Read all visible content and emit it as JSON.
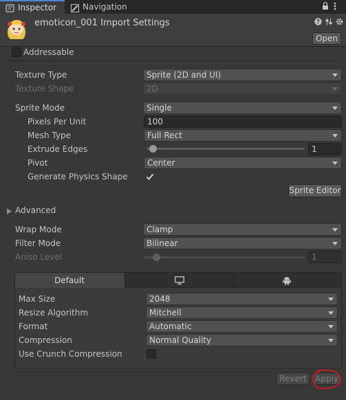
{
  "tabs": {
    "inspector": "Inspector",
    "navigation": "Navigation"
  },
  "header": {
    "title": "emoticon_001 Import Settings",
    "open_label": "Open"
  },
  "addressable": {
    "label": "Addressable",
    "checked": false
  },
  "texture_type": {
    "label": "Texture Type",
    "value": "Sprite (2D and UI)"
  },
  "texture_shape": {
    "label": "Texture Shape",
    "value": "2D"
  },
  "sprite_mode": {
    "label": "Sprite Mode",
    "value": "Single"
  },
  "pixels_per_unit": {
    "label": "Pixels Per Unit",
    "value": "100"
  },
  "mesh_type": {
    "label": "Mesh Type",
    "value": "Full Rect"
  },
  "extrude_edges": {
    "label": "Extrude Edges",
    "value": "1"
  },
  "pivot": {
    "label": "Pivot",
    "value": "Center"
  },
  "generate_physics": {
    "label": "Generate Physics Shape",
    "checked": true
  },
  "sprite_editor_label": "Sprite Editor",
  "advanced_label": "Advanced",
  "wrap_mode": {
    "label": "Wrap Mode",
    "value": "Clamp"
  },
  "filter_mode": {
    "label": "Filter Mode",
    "value": "Bilinear"
  },
  "aniso_level": {
    "label": "Aniso Level",
    "value": "1"
  },
  "platform": {
    "tabs": [
      "Default"
    ],
    "max_size": {
      "label": "Max Size",
      "value": "2048"
    },
    "resize_algorithm": {
      "label": "Resize Algorithm",
      "value": "Mitchell"
    },
    "format": {
      "label": "Format",
      "value": "Automatic"
    },
    "compression": {
      "label": "Compression",
      "value": "Normal Quality"
    },
    "crunch": {
      "label": "Use Crunch Compression",
      "checked": false
    }
  },
  "footer": {
    "revert_label": "Revert",
    "apply_label": "Apply"
  },
  "colors": {
    "background": "#383838",
    "annotation": "#e0161b",
    "tab_accent": "#4d86d6"
  },
  "icons": [
    "inspector-icon",
    "navigation-icon",
    "lock-icon",
    "menu-icon",
    "help-icon",
    "preset-icon",
    "settings-icon",
    "monitor-icon",
    "android-icon",
    "foldout-arrow-icon",
    "checkmark-icon",
    "dropdown-arrow-icon"
  ]
}
